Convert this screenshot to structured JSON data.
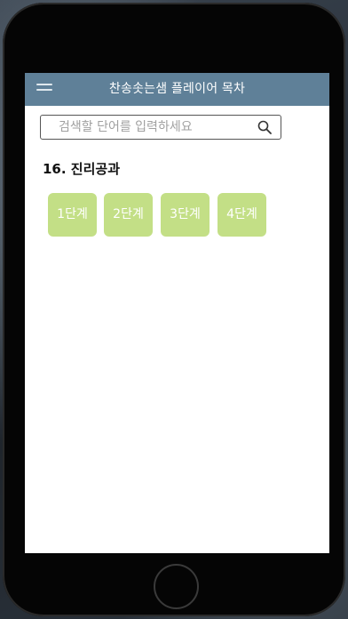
{
  "appbar": {
    "title": "찬송솟는샘 플레이어 목차"
  },
  "search": {
    "placeholder": "검색할 단어를 입력하세요",
    "value": ""
  },
  "section": {
    "title": "16. 진리공과"
  },
  "levels": [
    {
      "label": "1단계"
    },
    {
      "label": "2단계"
    },
    {
      "label": "3단계"
    },
    {
      "label": "4단계"
    }
  ],
  "colors": {
    "appbar": "#5f8098",
    "level_button": "#c3df86",
    "device_frame": "#050505"
  },
  "icons": {
    "menu": "hamburger-menu-icon",
    "search": "search-icon",
    "home": "home-button"
  }
}
